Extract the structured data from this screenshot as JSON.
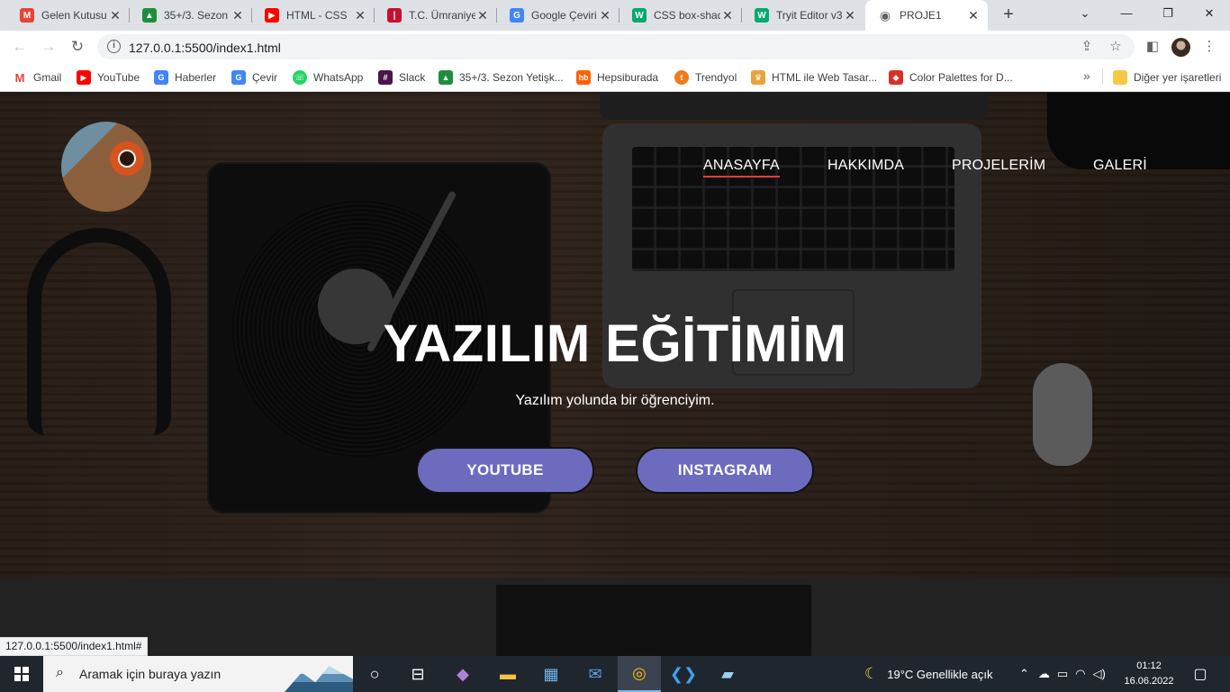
{
  "browser": {
    "tabs": [
      {
        "title": "Gelen Kutusu",
        "icon": "gmail-icon",
        "color": "#ea4335",
        "glyph": "M"
      },
      {
        "title": "35+/3. Sezon",
        "icon": "classroom-icon",
        "color": "#1e8e3e",
        "glyph": "▲"
      },
      {
        "title": "HTML - CSS",
        "icon": "youtube-icon",
        "color": "#ff0000",
        "glyph": "▶"
      },
      {
        "title": "T.C. Ümraniye",
        "icon": "tc-icon",
        "color": "#c8102e",
        "glyph": "|"
      },
      {
        "title": "Google Çeviri",
        "icon": "translate-icon",
        "color": "#4285f4",
        "glyph": "G"
      },
      {
        "title": "CSS box-shad",
        "icon": "w3schools-icon",
        "color": "#04aa6d",
        "glyph": "W"
      },
      {
        "title": "Tryit Editor v3",
        "icon": "w3schools-icon",
        "color": "#04aa6d",
        "glyph": "W"
      },
      {
        "title": "PROJE1",
        "icon": "globe-icon",
        "color": "#5f6368",
        "glyph": "◉"
      }
    ],
    "new_tab": "+",
    "window_controls": {
      "minimize": "—",
      "restore": "❐",
      "close": "✕",
      "tab_search": "⌄"
    },
    "url": "127.0.0.1:5500/index1.html",
    "bookmarks": [
      {
        "label": "Gmail",
        "icon": "gmail-icon",
        "color": "#ea4335",
        "glyph": "M"
      },
      {
        "label": "YouTube",
        "icon": "youtube-icon",
        "color": "#ff0000",
        "glyph": "▶"
      },
      {
        "label": "Haberler",
        "icon": "news-icon",
        "color": "#4285f4",
        "glyph": "G"
      },
      {
        "label": "Çevir",
        "icon": "translate-icon",
        "color": "#4285f4",
        "glyph": "G"
      },
      {
        "label": "WhatsApp",
        "icon": "whatsapp-icon",
        "color": "#25d366",
        "glyph": "☏"
      },
      {
        "label": "Slack",
        "icon": "slack-icon",
        "color": "#e01e5a",
        "glyph": "#"
      },
      {
        "label": "35+/3. Sezon Yetişk...",
        "icon": "classroom-icon",
        "color": "#1e8e3e",
        "glyph": "▲"
      },
      {
        "label": "Hepsiburada",
        "icon": "hepsiburada-icon",
        "color": "#ff6000",
        "glyph": "hb"
      },
      {
        "label": "Trendyol",
        "icon": "trendyol-icon",
        "color": "#f27a1a",
        "glyph": "t"
      },
      {
        "label": "HTML ile Web Tasar...",
        "icon": "bookmark-icon",
        "color": "#e8a33d",
        "glyph": "♛"
      },
      {
        "label": "Color Palettes for D...",
        "icon": "palette-icon",
        "color": "#d93025",
        "glyph": "◆"
      }
    ],
    "bookmarks_more": "»",
    "other_bookmarks": "Diğer yer işaretleri",
    "status_url": "127.0.0.1:5500/index1.html#"
  },
  "site": {
    "nav": [
      "ANASAYFA",
      "HAKKIMDA",
      "PROJELERİM",
      "GALERİ"
    ],
    "hero_title": "YAZILIM EĞİTİMİM",
    "hero_subtitle": "Yazılım yolunda bir öğrenciyim.",
    "buttons": [
      "YOUTUBE",
      "INSTAGRAM"
    ],
    "accent_color": "#6c6bbd",
    "nav_underline_color": "#e0403a"
  },
  "taskbar": {
    "search_placeholder": "Aramak için buraya yazın",
    "weather": "19°C  Genellikle açık",
    "time": "01:12",
    "date": "16.06.2022"
  }
}
